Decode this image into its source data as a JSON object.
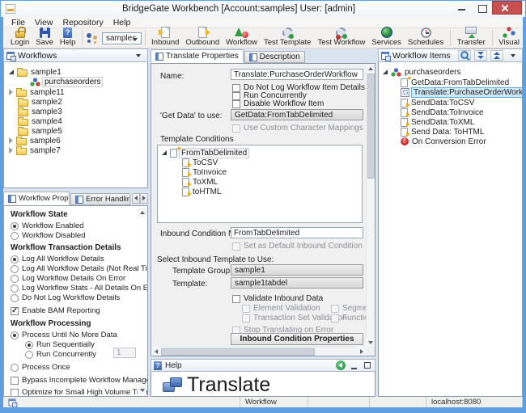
{
  "window": {
    "title": "BridgeGate Workbench [Account:samples] User: [admin]"
  },
  "menu": {
    "items": [
      "File",
      "View",
      "Repository",
      "Help"
    ]
  },
  "toolbar": {
    "login": "Login",
    "save": "Save",
    "help": "Help",
    "account_value": "samples",
    "inbound": "Inbound",
    "outbound": "Outbound",
    "workflow": "Workflow",
    "test_template": "Test Template",
    "test_workflow": "Test Workflow",
    "services": "Services",
    "schedules": "Schedules",
    "transfer": "Transfer",
    "visual": "Visual"
  },
  "workflows_panel": {
    "title": "Workflows",
    "items": [
      {
        "label": "sample1"
      },
      {
        "label": "purchaseorders"
      },
      {
        "label": "sample11"
      },
      {
        "label": "sample2"
      },
      {
        "label": "sample3"
      },
      {
        "label": "sample4"
      },
      {
        "label": "sample5"
      },
      {
        "label": "sample6"
      },
      {
        "label": "sample7"
      }
    ]
  },
  "props_panel": {
    "tabs": [
      "Workflow Properties",
      "Error Handling Pr"
    ],
    "state_header": "Workflow State",
    "enabled": "Workflow Enabled",
    "disabled": "Workflow Disabled",
    "trans_header": "Workflow Transaction Details",
    "log_all": "Log All Workflow Details",
    "log_all_nrt": "Log All Workflow Details (Not Real Time)",
    "log_on_error": "Log Workflow Details On Error",
    "log_stats": "Log Workflow Stats - All Details On Error",
    "no_log": "Do Not Log Workflow Details",
    "bam": "Enable BAM Reporting",
    "proc_header": "Workflow Processing",
    "proc_until": "Process Until No More Data",
    "run_seq": "Run Sequentially",
    "run_conc": "Run Concurrently",
    "conc_value": "1",
    "proc_once": "Process Once",
    "bypass": "Bypass Incomplete Workflow Manager",
    "optimize": "Optimize for Small High Volume Transactions"
  },
  "translate_panel": {
    "tabs": [
      "Translate Properties",
      "Description"
    ],
    "name_label": "Name:",
    "name_value": "Translate:PurchaseOrderWorkflow",
    "cb_do_not_log": "Do Not Log Workflow Item Details",
    "cb_run_conc": "Run Concurrently",
    "cb_disable": "Disable Workflow Item",
    "getdata_label": "'Get Data' to use:",
    "getdata_value": "GetData:FromTabDelimited",
    "cb_custom_map": "Use Custom Character Mappings",
    "template_conditions_label": "Template Conditions",
    "condition_tree": {
      "root": "FromTabDelimited",
      "children": [
        "ToCSV",
        "ToInvoice",
        "ToXML",
        "toHTML"
      ]
    },
    "inbound_name_label": "Inbound Condition Name:",
    "inbound_name_value": "FromTabDelimited",
    "cb_default_inbound": "Set as Default Inbound Condition",
    "select_template_label": "Select Inbound Template to Use:",
    "template_group_label": "Template Group:",
    "template_group_value": "sample1",
    "template_label": "Template:",
    "template_value": "sample1tabdel",
    "cb_validate": "Validate Inbound Data",
    "cb_element": "Element Validation",
    "cb_segment": "Segment Va",
    "cb_transaction": "Transaction Set Validation",
    "cb_functional": "Functional G",
    "cb_stop": "Stop Translating on Error",
    "inbound_props_button": "Inbound Condition Properties"
  },
  "help_panel": {
    "title": "Help",
    "heading": "Translate"
  },
  "items_panel": {
    "title": "Workflow Items",
    "items": [
      {
        "label": "purchaseorders"
      },
      {
        "label": "GetData:FromTabDelimited"
      },
      {
        "label": "Translate:PurchaseOrderWorkflow"
      },
      {
        "label": "SendData:ToCSV"
      },
      {
        "label": "SendData:ToInvoice"
      },
      {
        "label": "SendData:ToXML"
      },
      {
        "label": "Send Data: ToHTML"
      },
      {
        "label": "On Conversion Error"
      }
    ]
  },
  "status_bar": {
    "workflow": "Workflow",
    "host": "localhost:8080"
  }
}
